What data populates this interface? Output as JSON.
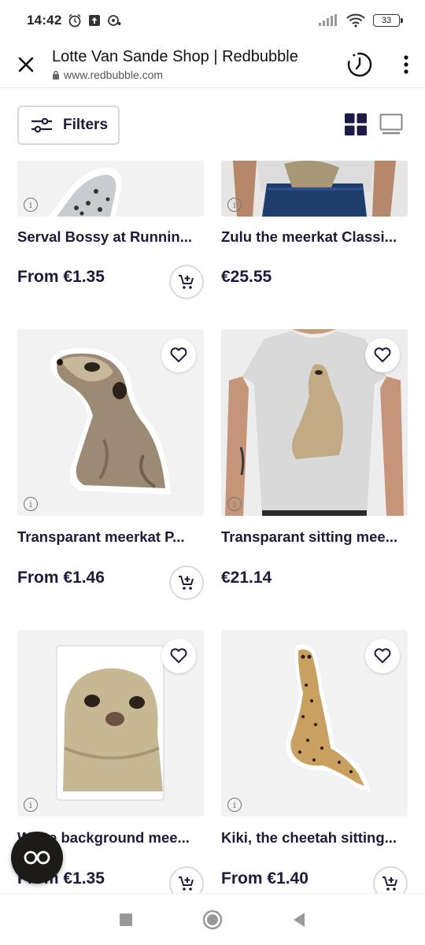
{
  "status_bar": {
    "time": "14:42",
    "battery": "33"
  },
  "app_bar": {
    "title": "Lotte Van Sande Shop | Redbubble",
    "url": "www.redbubble.com"
  },
  "filters": {
    "label": "Filters"
  },
  "products": [
    {
      "title": "Serval Bossy at Runnin...",
      "price": "From €1.35"
    },
    {
      "title": "Zulu the meerkat Classi...",
      "price": "€25.55"
    },
    {
      "title": "Transparant meerkat P...",
      "price": "From €1.46"
    },
    {
      "title": "Transparant sitting mee...",
      "price": "€21.14"
    },
    {
      "title": "White background mee...",
      "price": "From €1.35"
    },
    {
      "title": "Kiki, the cheetah sitting...",
      "price": "From €1.40"
    }
  ],
  "colors": {
    "brand_text": "#1d1a3a",
    "card_bg": "#f2f2f3",
    "fab_bg": "#1d1a1a"
  }
}
